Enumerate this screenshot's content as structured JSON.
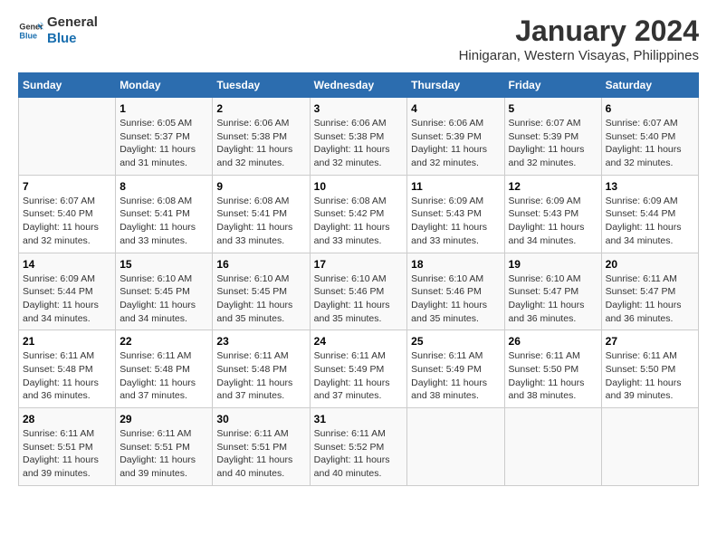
{
  "logo": {
    "line1": "General",
    "line2": "Blue"
  },
  "title": "January 2024",
  "subtitle": "Hinigaran, Western Visayas, Philippines",
  "days_of_week": [
    "Sunday",
    "Monday",
    "Tuesday",
    "Wednesday",
    "Thursday",
    "Friday",
    "Saturday"
  ],
  "weeks": [
    [
      {
        "day": "",
        "content": ""
      },
      {
        "day": "1",
        "content": "Sunrise: 6:05 AM\nSunset: 5:37 PM\nDaylight: 11 hours\nand 31 minutes."
      },
      {
        "day": "2",
        "content": "Sunrise: 6:06 AM\nSunset: 5:38 PM\nDaylight: 11 hours\nand 32 minutes."
      },
      {
        "day": "3",
        "content": "Sunrise: 6:06 AM\nSunset: 5:38 PM\nDaylight: 11 hours\nand 32 minutes."
      },
      {
        "day": "4",
        "content": "Sunrise: 6:06 AM\nSunset: 5:39 PM\nDaylight: 11 hours\nand 32 minutes."
      },
      {
        "day": "5",
        "content": "Sunrise: 6:07 AM\nSunset: 5:39 PM\nDaylight: 11 hours\nand 32 minutes."
      },
      {
        "day": "6",
        "content": "Sunrise: 6:07 AM\nSunset: 5:40 PM\nDaylight: 11 hours\nand 32 minutes."
      }
    ],
    [
      {
        "day": "7",
        "content": "Sunrise: 6:07 AM\nSunset: 5:40 PM\nDaylight: 11 hours\nand 32 minutes."
      },
      {
        "day": "8",
        "content": "Sunrise: 6:08 AM\nSunset: 5:41 PM\nDaylight: 11 hours\nand 33 minutes."
      },
      {
        "day": "9",
        "content": "Sunrise: 6:08 AM\nSunset: 5:41 PM\nDaylight: 11 hours\nand 33 minutes."
      },
      {
        "day": "10",
        "content": "Sunrise: 6:08 AM\nSunset: 5:42 PM\nDaylight: 11 hours\nand 33 minutes."
      },
      {
        "day": "11",
        "content": "Sunrise: 6:09 AM\nSunset: 5:43 PM\nDaylight: 11 hours\nand 33 minutes."
      },
      {
        "day": "12",
        "content": "Sunrise: 6:09 AM\nSunset: 5:43 PM\nDaylight: 11 hours\nand 34 minutes."
      },
      {
        "day": "13",
        "content": "Sunrise: 6:09 AM\nSunset: 5:44 PM\nDaylight: 11 hours\nand 34 minutes."
      }
    ],
    [
      {
        "day": "14",
        "content": "Sunrise: 6:09 AM\nSunset: 5:44 PM\nDaylight: 11 hours\nand 34 minutes."
      },
      {
        "day": "15",
        "content": "Sunrise: 6:10 AM\nSunset: 5:45 PM\nDaylight: 11 hours\nand 34 minutes."
      },
      {
        "day": "16",
        "content": "Sunrise: 6:10 AM\nSunset: 5:45 PM\nDaylight: 11 hours\nand 35 minutes."
      },
      {
        "day": "17",
        "content": "Sunrise: 6:10 AM\nSunset: 5:46 PM\nDaylight: 11 hours\nand 35 minutes."
      },
      {
        "day": "18",
        "content": "Sunrise: 6:10 AM\nSunset: 5:46 PM\nDaylight: 11 hours\nand 35 minutes."
      },
      {
        "day": "19",
        "content": "Sunrise: 6:10 AM\nSunset: 5:47 PM\nDaylight: 11 hours\nand 36 minutes."
      },
      {
        "day": "20",
        "content": "Sunrise: 6:11 AM\nSunset: 5:47 PM\nDaylight: 11 hours\nand 36 minutes."
      }
    ],
    [
      {
        "day": "21",
        "content": "Sunrise: 6:11 AM\nSunset: 5:48 PM\nDaylight: 11 hours\nand 36 minutes."
      },
      {
        "day": "22",
        "content": "Sunrise: 6:11 AM\nSunset: 5:48 PM\nDaylight: 11 hours\nand 37 minutes."
      },
      {
        "day": "23",
        "content": "Sunrise: 6:11 AM\nSunset: 5:48 PM\nDaylight: 11 hours\nand 37 minutes."
      },
      {
        "day": "24",
        "content": "Sunrise: 6:11 AM\nSunset: 5:49 PM\nDaylight: 11 hours\nand 37 minutes."
      },
      {
        "day": "25",
        "content": "Sunrise: 6:11 AM\nSunset: 5:49 PM\nDaylight: 11 hours\nand 38 minutes."
      },
      {
        "day": "26",
        "content": "Sunrise: 6:11 AM\nSunset: 5:50 PM\nDaylight: 11 hours\nand 38 minutes."
      },
      {
        "day": "27",
        "content": "Sunrise: 6:11 AM\nSunset: 5:50 PM\nDaylight: 11 hours\nand 39 minutes."
      }
    ],
    [
      {
        "day": "28",
        "content": "Sunrise: 6:11 AM\nSunset: 5:51 PM\nDaylight: 11 hours\nand 39 minutes."
      },
      {
        "day": "29",
        "content": "Sunrise: 6:11 AM\nSunset: 5:51 PM\nDaylight: 11 hours\nand 39 minutes."
      },
      {
        "day": "30",
        "content": "Sunrise: 6:11 AM\nSunset: 5:51 PM\nDaylight: 11 hours\nand 40 minutes."
      },
      {
        "day": "31",
        "content": "Sunrise: 6:11 AM\nSunset: 5:52 PM\nDaylight: 11 hours\nand 40 minutes."
      },
      {
        "day": "",
        "content": ""
      },
      {
        "day": "",
        "content": ""
      },
      {
        "day": "",
        "content": ""
      }
    ]
  ]
}
